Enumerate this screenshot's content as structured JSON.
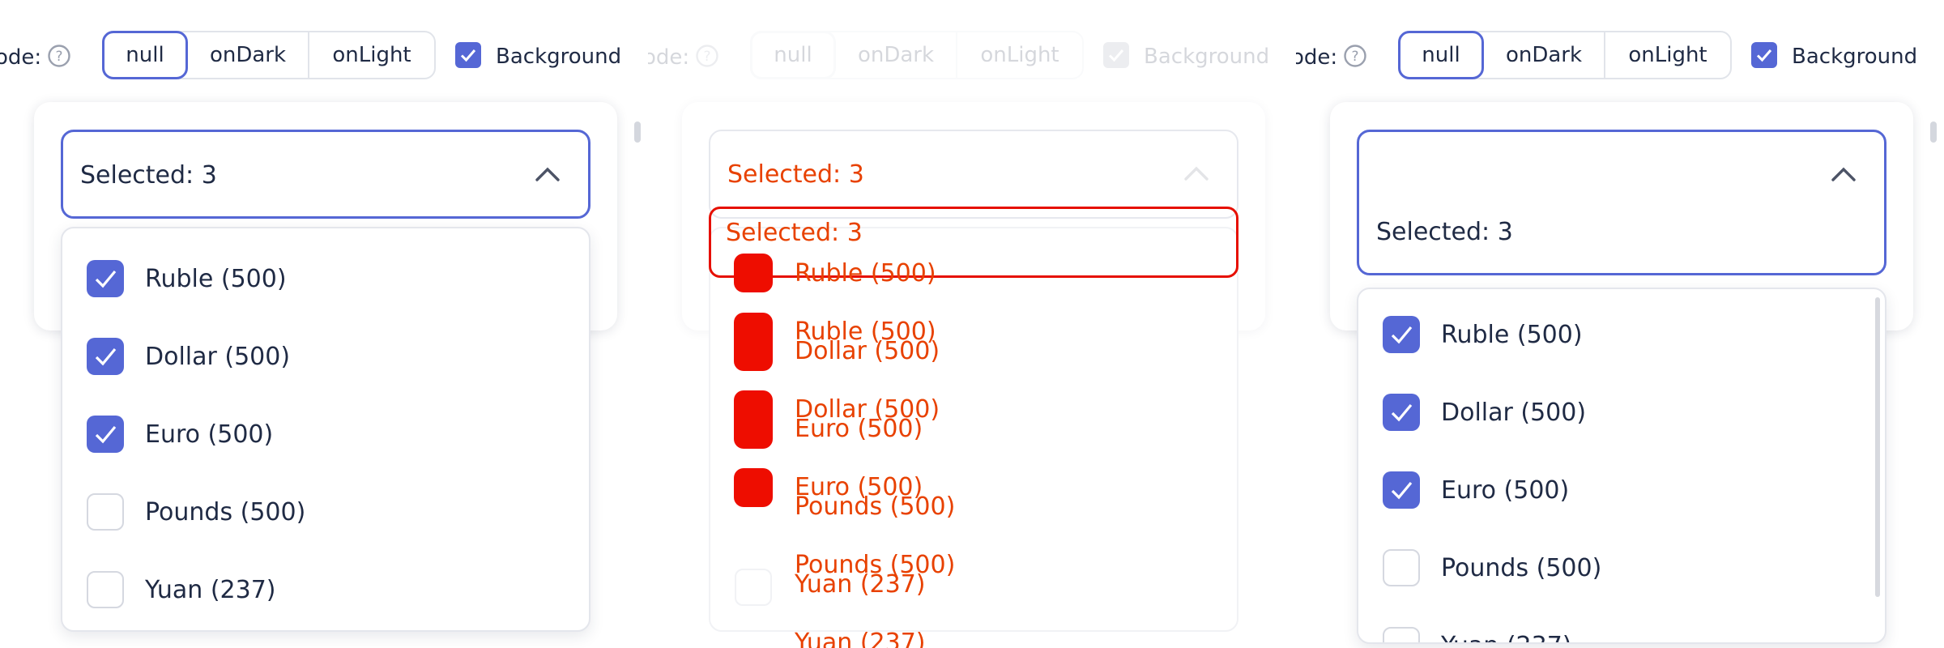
{
  "toolbar": {
    "mode_label": "ode:",
    "modes": [
      "null",
      "onDark",
      "onLight"
    ],
    "selected_mode": "null",
    "background_label": "Background",
    "background_checked": true
  },
  "select": {
    "value": "Selected: 3",
    "expanded": true
  },
  "options": [
    {
      "label": "Ruble (500)",
      "checked": true
    },
    {
      "label": "Dollar (500)",
      "checked": true
    },
    {
      "label": "Euro (500)",
      "checked": true
    },
    {
      "label": "Pounds (500)",
      "checked": false
    },
    {
      "label": "Yuan (237)",
      "checked": false
    }
  ],
  "colors": {
    "accent": "#5567d5",
    "text": "#1f2a44",
    "border": "#e1e4ea",
    "diff_red": "#ee0d00",
    "diff_orange": "#e84100"
  },
  "icons": {
    "help": "question-circle-icon",
    "chevron": "chevron-up-icon",
    "check": "checkmark-icon"
  }
}
